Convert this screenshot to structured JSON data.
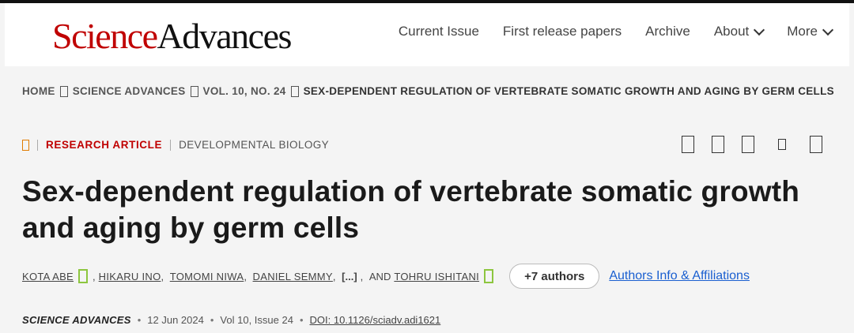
{
  "header": {
    "logo_science": "Science",
    "logo_advances": "Advances",
    "nav": [
      "Current Issue",
      "First release papers",
      "Archive",
      "About",
      "More"
    ]
  },
  "breadcrumb": [
    "HOME",
    "SCIENCE ADVANCES",
    "VOL. 10, NO. 24",
    "SEX-DEPENDENT REGULATION OF VERTEBRATE SOMATIC GROWTH AND AGING BY GERM CELLS"
  ],
  "article": {
    "type": "RESEARCH ARTICLE",
    "subject": "DEVELOPMENTAL BIOLOGY",
    "title": "Sex-dependent regulation of vertebrate somatic growth and aging by germ cells",
    "authors": {
      "a1": "KOTA ABE",
      "a2": "HIKARU INO",
      "a3": "TOMOMI NIWA",
      "a4": "DANIEL SEMMY",
      "ellipsis": "[...]",
      "and": "AND",
      "a5": "TOHRU ISHITANI",
      "more_button": "+7 authors",
      "affiliations_link": "Authors Info & Affiliations"
    },
    "pub": {
      "journal": "SCIENCE ADVANCES",
      "date": "12 Jun 2024",
      "issue": "Vol 10, Issue 24",
      "doi": "DOI: 10.1126/sciadv.adi1621"
    }
  },
  "icons": {
    "breadcrumb_separator": "box-glyph",
    "open_access": "open-access-icon",
    "orcid": "orcid-icon",
    "tools": [
      "pdf-icon",
      "bookmark-icon",
      "share-icon",
      "cite-icon",
      "permissions-icon"
    ]
  },
  "colors": {
    "brand_red": "#c00000",
    "orcid_green": "#8dc63f",
    "open_access_orange": "#e07b00",
    "link_blue": "#1a5fd0"
  }
}
